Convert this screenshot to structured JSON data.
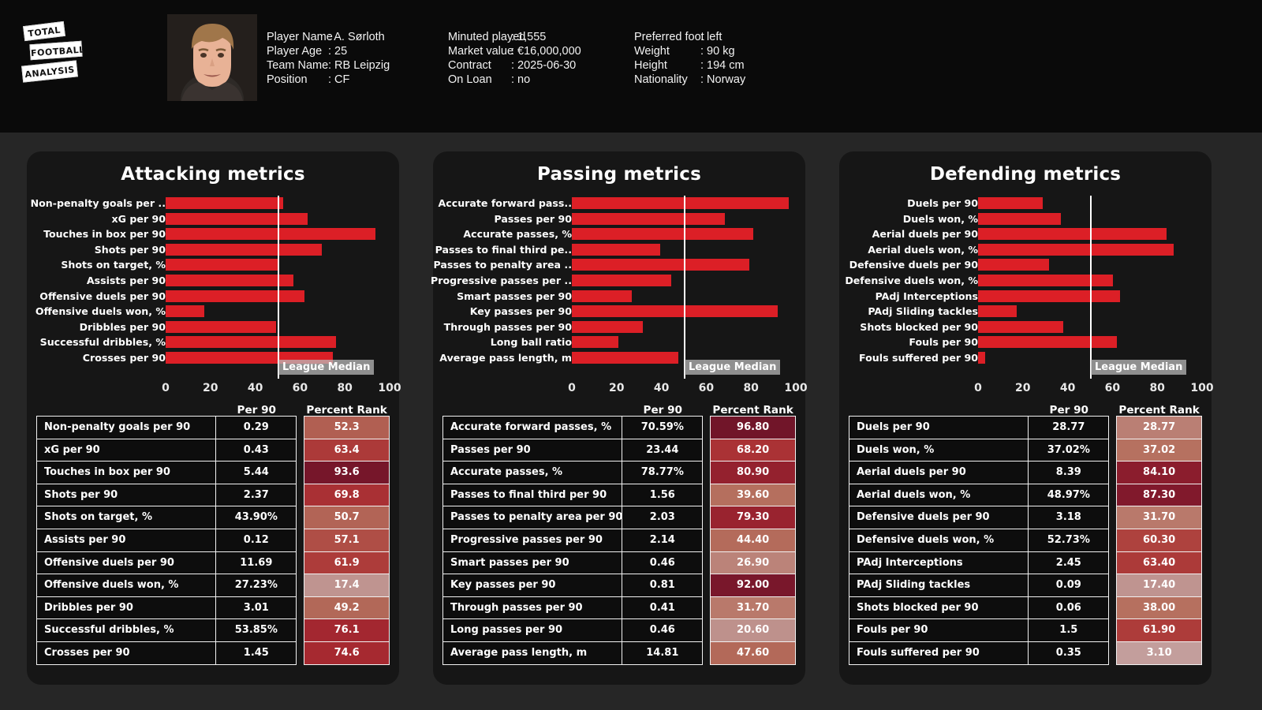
{
  "brand": {
    "line1": "TOTAL",
    "line2": "FOOTBALL",
    "line3": "ANALYSIS"
  },
  "player": {
    "col1": [
      {
        "key": "Player Name",
        "value": ": A. Sørloth"
      },
      {
        "key": "Player Age",
        "value": ": 25"
      },
      {
        "key": "Team Name",
        "value": ": RB Leipzig"
      },
      {
        "key": "Position",
        "value": ": CF"
      }
    ],
    "col2": [
      {
        "key": "Minuted played",
        "value": ": 1,555"
      },
      {
        "key": "Market value",
        "value": ": €16,000,000"
      },
      {
        "key": "Contract",
        "value": ": 2025-06-30"
      },
      {
        "key": "On Loan",
        "value": ": no"
      }
    ],
    "col3": [
      {
        "key": "Preferred foot",
        "value": ": left"
      },
      {
        "key": "Weight",
        "value": ": 90 kg"
      },
      {
        "key": "Height",
        "value": ": 194 cm"
      },
      {
        "key": "Nationality",
        "value": ": Norway"
      }
    ]
  },
  "colors": {
    "bar": "#dc1f26",
    "median_line": "#ffffff",
    "card_bg": "#161616",
    "page_bg": "#262626",
    "header_bg": "#0a0a0a"
  },
  "table_headers": {
    "metric": "",
    "per90": "Per 90",
    "rank": "Percent Rank"
  },
  "median_label": "League Median",
  "axis": {
    "ticks": [
      0,
      20,
      40,
      60,
      80,
      100
    ],
    "min": 0,
    "max": 100,
    "median": 50
  },
  "chart_data": [
    {
      "type": "bar",
      "title": "Attacking metrics",
      "orientation": "horizontal",
      "xlabel": "",
      "ylabel": "",
      "xlim": [
        0,
        100
      ],
      "grid": false,
      "legend": "League Median",
      "annotations": [
        "League Median reference line at 50"
      ],
      "categories": [
        "Non-penalty goals per ..",
        "xG per 90",
        "Touches in box per 90",
        "Shots per 90",
        "Shots on target, %",
        "Assists per 90",
        "Offensive duels per 90",
        "Offensive duels won, %",
        "Dribbles per 90",
        "Successful dribbles, %",
        "Crosses per 90"
      ],
      "values": [
        52.3,
        63.4,
        93.6,
        69.8,
        50.7,
        57.1,
        61.9,
        17.4,
        49.2,
        76.1,
        74.6
      ],
      "table": {
        "columns": [
          "",
          "Per 90",
          "Percent Rank"
        ],
        "rows": [
          {
            "metric": "Non-penalty goals per 90",
            "per90": "0.29",
            "rank": "52.3",
            "rank_value": 52.3
          },
          {
            "metric": "xG per 90",
            "per90": "0.43",
            "rank": "63.4",
            "rank_value": 63.4
          },
          {
            "metric": "Touches in box per 90",
            "per90": "5.44",
            "rank": "93.6",
            "rank_value": 93.6
          },
          {
            "metric": "Shots per 90",
            "per90": "2.37",
            "rank": "69.8",
            "rank_value": 69.8
          },
          {
            "metric": "Shots on target, %",
            "per90": "43.90%",
            "rank": "50.7",
            "rank_value": 50.7
          },
          {
            "metric": "Assists per 90",
            "per90": "0.12",
            "rank": "57.1",
            "rank_value": 57.1
          },
          {
            "metric": "Offensive duels per 90",
            "per90": "11.69",
            "rank": "61.9",
            "rank_value": 61.9
          },
          {
            "metric": "Offensive duels won, %",
            "per90": "27.23%",
            "rank": "17.4",
            "rank_value": 17.4
          },
          {
            "metric": "Dribbles per 90",
            "per90": "3.01",
            "rank": "49.2",
            "rank_value": 49.2
          },
          {
            "metric": "Successful dribbles, %",
            "per90": "53.85%",
            "rank": "76.1",
            "rank_value": 76.1
          },
          {
            "metric": "Crosses per 90",
            "per90": "1.45",
            "rank": "74.6",
            "rank_value": 74.6
          }
        ]
      }
    },
    {
      "type": "bar",
      "title": "Passing metrics",
      "orientation": "horizontal",
      "xlabel": "",
      "ylabel": "",
      "xlim": [
        0,
        100
      ],
      "grid": false,
      "legend": "League Median",
      "annotations": [
        "League Median reference line at 50"
      ],
      "categories": [
        "Accurate forward pass..",
        "Passes per 90",
        "Accurate passes, %",
        "Passes to final third pe..",
        "Passes to penalty area ..",
        "Progressive passes per ..",
        "Smart passes per 90",
        "Key passes per 90",
        "Through passes per 90",
        "Long ball ratio",
        "Average pass length, m"
      ],
      "values": [
        96.8,
        68.2,
        80.9,
        39.6,
        79.3,
        44.4,
        26.9,
        92.0,
        31.7,
        20.6,
        47.6
      ],
      "table": {
        "columns": [
          "",
          "Per 90",
          "Percent Rank"
        ],
        "rows": [
          {
            "metric": "Accurate forward passes, %",
            "per90": "70.59%",
            "rank": "96.80",
            "rank_value": 96.8
          },
          {
            "metric": "Passes per 90",
            "per90": "23.44",
            "rank": "68.20",
            "rank_value": 68.2
          },
          {
            "metric": "Accurate passes, %",
            "per90": "78.77%",
            "rank": "80.90",
            "rank_value": 80.9
          },
          {
            "metric": "Passes to final third per 90",
            "per90": "1.56",
            "rank": "39.60",
            "rank_value": 39.6
          },
          {
            "metric": "Passes to penalty area per 90",
            "per90": "2.03",
            "rank": "79.30",
            "rank_value": 79.3
          },
          {
            "metric": "Progressive passes per 90",
            "per90": "2.14",
            "rank": "44.40",
            "rank_value": 44.4
          },
          {
            "metric": "Smart passes per 90",
            "per90": "0.46",
            "rank": "26.90",
            "rank_value": 26.9
          },
          {
            "metric": "Key passes per 90",
            "per90": "0.81",
            "rank": "92.00",
            "rank_value": 92.0
          },
          {
            "metric": "Through passes per 90",
            "per90": "0.41",
            "rank": "31.70",
            "rank_value": 31.7
          },
          {
            "metric": "Long passes per 90",
            "per90": "0.46",
            "rank": "20.60",
            "rank_value": 20.6
          },
          {
            "metric": "Average pass length, m",
            "per90": "14.81",
            "rank": "47.60",
            "rank_value": 47.6
          }
        ]
      }
    },
    {
      "type": "bar",
      "title": "Defending metrics",
      "orientation": "horizontal",
      "xlabel": "",
      "ylabel": "",
      "xlim": [
        0,
        100
      ],
      "grid": false,
      "legend": "League Median",
      "annotations": [
        "League Median reference line at 50"
      ],
      "categories": [
        "Duels per 90",
        "Duels won, %",
        "Aerial duels per 90",
        "Aerial duels won, %",
        "Defensive duels per 90",
        "Defensive duels won, %",
        "PAdj Interceptions",
        "PAdj Sliding tackles",
        "Shots blocked per 90",
        "Fouls per 90",
        "Fouls suffered per 90"
      ],
      "values": [
        28.77,
        37.02,
        84.1,
        87.3,
        31.7,
        60.3,
        63.4,
        17.4,
        38.0,
        61.9,
        3.1
      ],
      "table": {
        "columns": [
          "",
          "Per 90",
          "Percent Rank"
        ],
        "rows": [
          {
            "metric": "Duels per 90",
            "per90": "28.77",
            "rank": "28.77",
            "rank_value": 28.77
          },
          {
            "metric": "Duels won, %",
            "per90": "37.02%",
            "rank": "37.02",
            "rank_value": 37.02
          },
          {
            "metric": "Aerial duels per 90",
            "per90": "8.39",
            "rank": "84.10",
            "rank_value": 84.1
          },
          {
            "metric": "Aerial duels won, %",
            "per90": "48.97%",
            "rank": "87.30",
            "rank_value": 87.3
          },
          {
            "metric": "Defensive duels per 90",
            "per90": "3.18",
            "rank": "31.70",
            "rank_value": 31.7
          },
          {
            "metric": "Defensive duels won, %",
            "per90": "52.73%",
            "rank": "60.30",
            "rank_value": 60.3
          },
          {
            "metric": "PAdj Interceptions",
            "per90": "2.45",
            "rank": "63.40",
            "rank_value": 63.4
          },
          {
            "metric": "PAdj Sliding tackles",
            "per90": "0.09",
            "rank": "17.40",
            "rank_value": 17.4
          },
          {
            "metric": "Shots blocked per 90",
            "per90": "0.06",
            "rank": "38.00",
            "rank_value": 38.0
          },
          {
            "metric": "Fouls per 90",
            "per90": "1.5",
            "rank": "61.90",
            "rank_value": 61.9
          },
          {
            "metric": "Fouls suffered per 90",
            "per90": "0.35",
            "rank": "3.10",
            "rank_value": 3.1
          }
        ]
      }
    }
  ]
}
